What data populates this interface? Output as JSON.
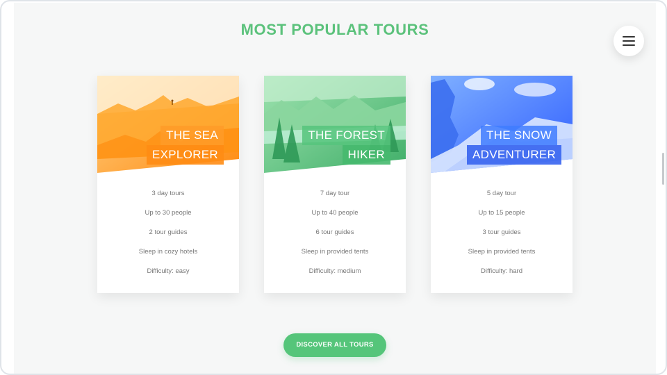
{
  "page": {
    "title": "MOST POPULAR TOURS",
    "cta_label": "DISCOVER ALL TOURS",
    "accent_color": "#55c57a"
  },
  "menu": {
    "icon": "hamburger-menu-icon"
  },
  "tours": [
    {
      "heading_line1": "THE SEA",
      "heading_line2": "EXPLORER",
      "color": "#ff9b28",
      "details": [
        "3 day tours",
        "Up to 30 people",
        "2 tour guides",
        "Sleep in cozy hotels",
        "Difficulty: easy"
      ]
    },
    {
      "heading_line1": "THE FOREST",
      "heading_line2": "HIKER",
      "color": "#56c47c",
      "details": [
        "7 day tour",
        "Up to 40 people",
        "6 tour guides",
        "Sleep in provided tents",
        "Difficulty: medium"
      ]
    },
    {
      "heading_line1": "THE SNOW",
      "heading_line2": "ADVENTURER",
      "color": "#3f7dff",
      "details": [
        "5 day tour",
        "Up to 15 people",
        "3 tour guides",
        "Sleep in provided tents",
        "Difficulty: hard"
      ]
    }
  ]
}
